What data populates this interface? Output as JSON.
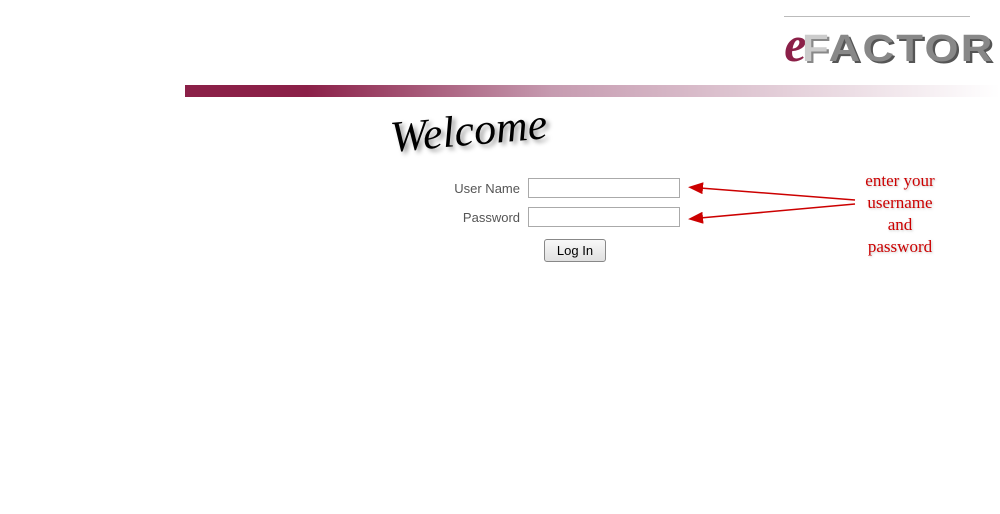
{
  "logo": {
    "prefix": "e",
    "text": "FACTOR"
  },
  "welcome": "Welcome",
  "form": {
    "username_label": "User Name",
    "username_value": "",
    "password_label": "Password",
    "password_value": "",
    "login_button": "Log In"
  },
  "annotation": {
    "line1": "enter your",
    "line2": "username",
    "line3": "and",
    "line4": "password"
  },
  "colors": {
    "brand": "#8b2048",
    "annotation": "#cc0000"
  }
}
